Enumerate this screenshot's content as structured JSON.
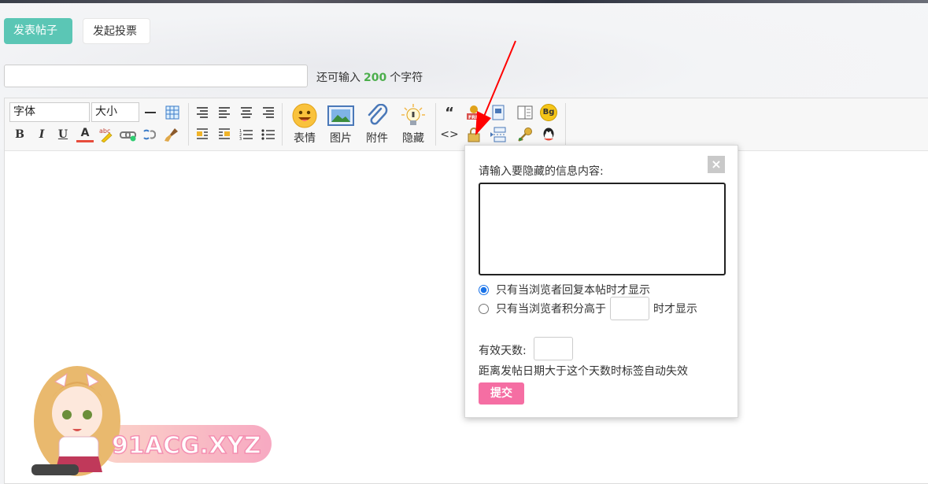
{
  "tabs": {
    "post_label": "发表帖子",
    "poll_label": "发起投票"
  },
  "title_field": {
    "value": "",
    "placeholder": ""
  },
  "char_hint": {
    "prefix": "还可输入",
    "count": "200",
    "suffix": "个字符"
  },
  "toolbar": {
    "font_select": "字体",
    "size_select": "大小",
    "emoji_label": "表情",
    "image_label": "图片",
    "attach_label": "附件",
    "hide_label": "隐藏",
    "bold": "B",
    "italic": "I",
    "underline": "U",
    "color": "A",
    "quote": "“",
    "code": "<>",
    "bg": "Bg"
  },
  "hide_popup": {
    "title": "请输入要隐藏的信息内容:",
    "close": "×",
    "option_reply": "只有当浏览者回复本帖时才显示",
    "option_points_prefix": "只有当浏览者积分高于",
    "option_points_suffix": "时才显示",
    "days_label": "有效天数:",
    "days_hint": "距离发帖日期大于这个天数时标签自动失效",
    "submit": "提交"
  },
  "watermark": {
    "text": "91ACG.XYZ"
  },
  "colors": {
    "accent_green": "#5bc6b5",
    "submit_pink": "#f56ea3",
    "arrow_red": "#ff0000"
  }
}
